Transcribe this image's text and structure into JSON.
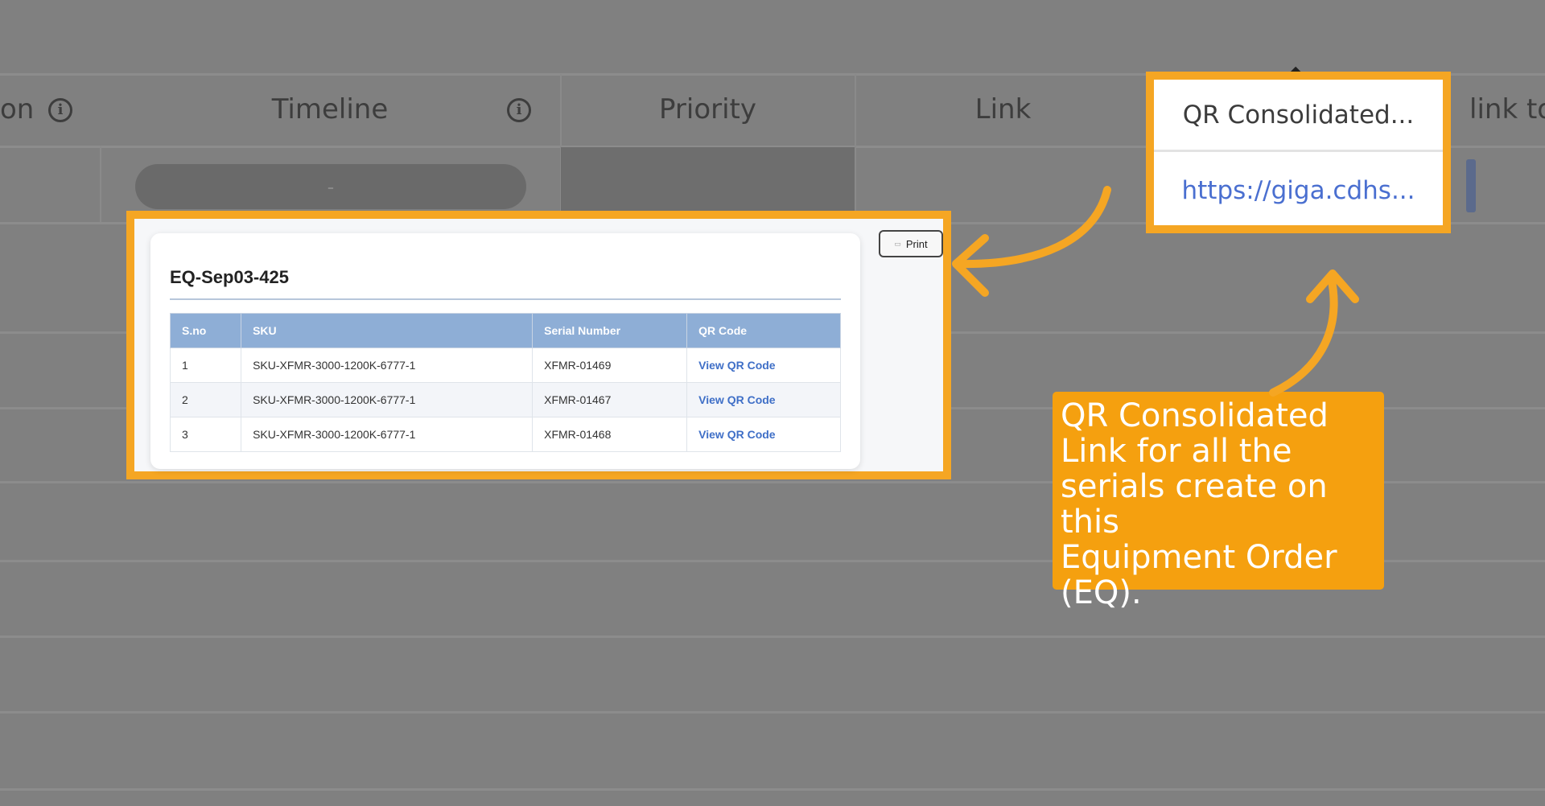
{
  "table_header": {
    "col_partial_left": "on",
    "timeline": "Timeline",
    "priority": "Priority",
    "link": "Link",
    "qr_consolidated": "QR Consolidated...",
    "col_partial_right": "link to"
  },
  "row": {
    "timeline_value": "-",
    "qr_consolidated_value": "https://giga.cdhs..."
  },
  "preview": {
    "title": "EQ-Sep03-425",
    "print_label": "Print",
    "columns": [
      "S.no",
      "SKU",
      "Serial Number",
      "QR Code"
    ],
    "rows": [
      {
        "sno": "1",
        "sku": "SKU-XFMR-3000-1200K-6777-1",
        "serial": "XFMR-01469",
        "qr": "View QR Code"
      },
      {
        "sno": "2",
        "sku": "SKU-XFMR-3000-1200K-6777-1",
        "serial": "XFMR-01467",
        "qr": "View QR Code"
      },
      {
        "sno": "3",
        "sku": "SKU-XFMR-3000-1200K-6777-1",
        "serial": "XFMR-01468",
        "qr": "View QR Code"
      }
    ]
  },
  "callout": {
    "text": "QR Consolidated\nLink for all the\nserials create on this\nEquipment Order\n(EQ)."
  },
  "colors": {
    "highlight": "#f5a623",
    "callout_bg": "#f5a00f",
    "table_header_bg": "#8eaed6",
    "link": "#3f6fc7"
  },
  "icons": [
    "info-icon",
    "print-icon",
    "sort-caret-icon",
    "curved-arrow-icon"
  ]
}
